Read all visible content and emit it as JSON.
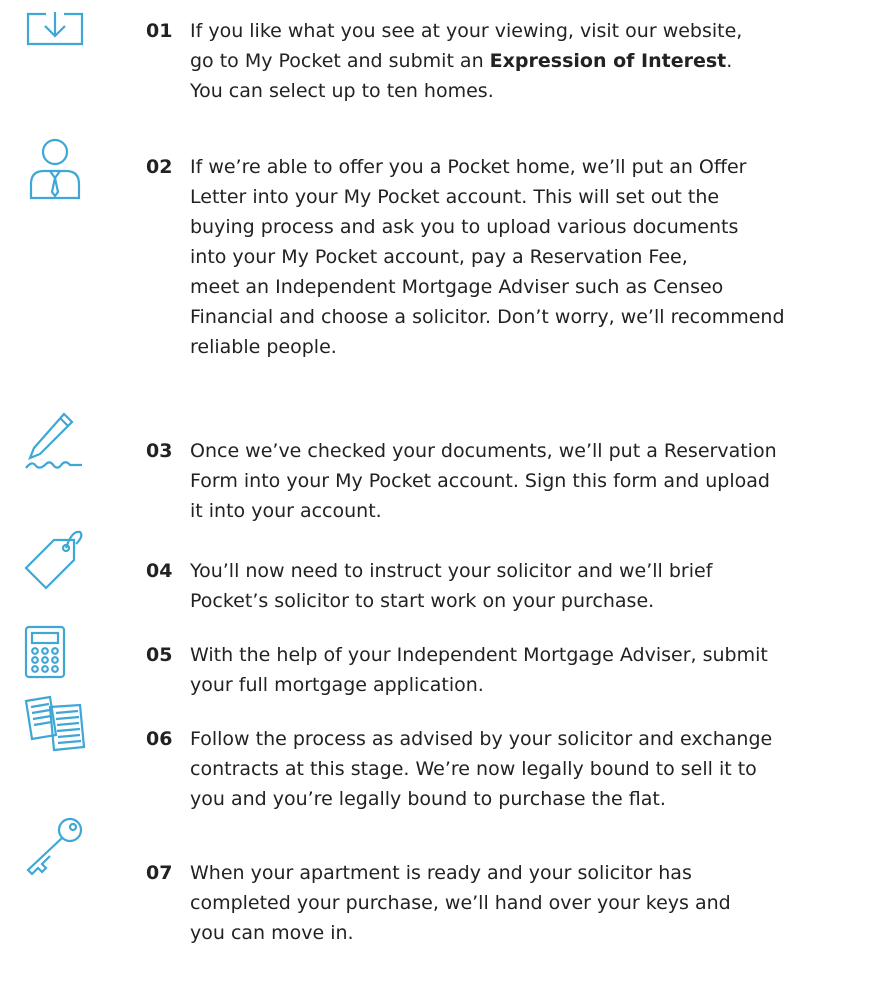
{
  "accent_color": "#3ea7d6",
  "steps": [
    {
      "icon": "download-icon",
      "number": "01",
      "lines": [
        "If you like what you see at your viewing, visit our website,",
        "go to My Pocket and submit an ",
        "You can select up to ten homes."
      ],
      "bold": "Expression of Interest",
      "after_bold": "."
    },
    {
      "icon": "person-icon",
      "number": "02",
      "lines": [
        "If we’re able to offer you a Pocket home, we’ll put an Offer",
        "Letter into your My Pocket account. This will set out the",
        "buying process and ask you to upload various documents",
        "into your My Pocket account, pay a Reservation Fee,",
        "meet an Independent Mortgage Adviser such as Censeo",
        "Financial and choose a solicitor. Don’t worry, we’ll recommend",
        "reliable people."
      ]
    },
    {
      "icon": "pen-signature-icon",
      "number": "03",
      "lines": [
        "Once we’ve checked your documents, we’ll put a Reservation",
        "Form into your My Pocket account. Sign this form and upload",
        "it into your account."
      ]
    },
    {
      "icon": "price-tag-icon",
      "number": "04",
      "lines": [
        "You’ll now need to instruct your solicitor and we’ll brief",
        "Pocket’s solicitor to start work on your purchase."
      ]
    },
    {
      "icon": "calculator-icon",
      "number": "05",
      "lines": [
        "With the help of your Independent Mortgage Adviser, submit",
        "your full mortgage application."
      ]
    },
    {
      "icon": "documents-icon",
      "number": "06",
      "lines": [
        "Follow the process as advised by your solicitor and exchange",
        "contracts at this stage. We’re now legally bound to sell it to",
        "you and you’re legally bound to purchase the flat."
      ]
    },
    {
      "icon": "key-icon",
      "number": "07",
      "lines": [
        "When your apartment is ready and your solicitor has",
        "completed your purchase, we’ll hand over your keys and",
        "you can move in."
      ]
    }
  ]
}
